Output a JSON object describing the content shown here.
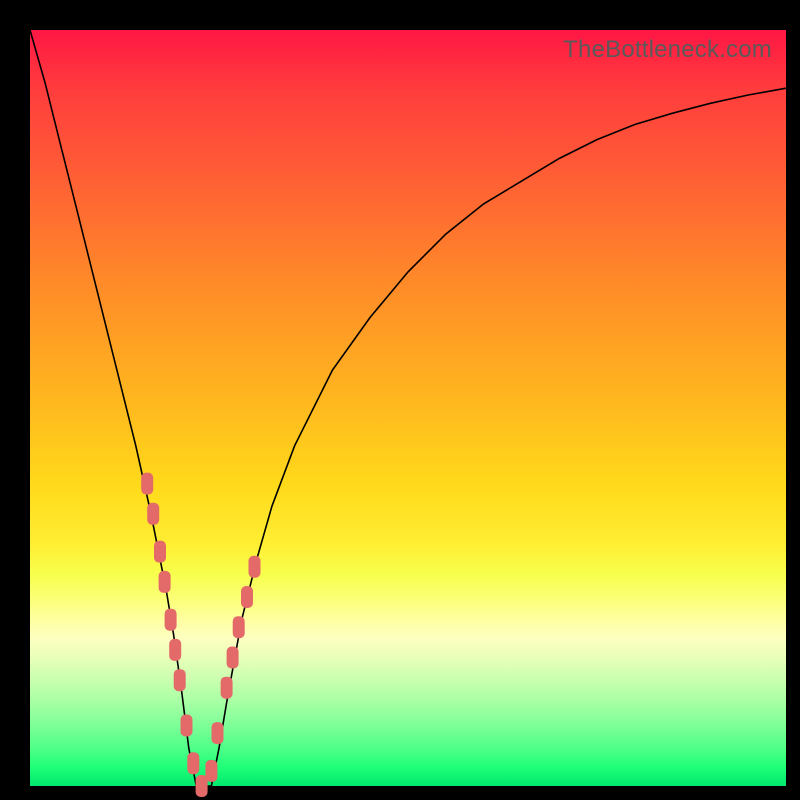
{
  "watermark": "TheBottleneck.com",
  "colors": {
    "frame": "#000000",
    "markers": "#e46a6a",
    "curve": "#000000",
    "gradient_top": "#ff1744",
    "gradient_bottom": "#00e86e"
  },
  "chart_data": {
    "type": "line",
    "title": "",
    "xlabel": "",
    "ylabel": "",
    "xlim": [
      0,
      100
    ],
    "ylim": [
      0,
      100
    ],
    "grid": false,
    "series": [
      {
        "name": "bottleneck-curve",
        "x": [
          0,
          2,
          4,
          6,
          8,
          10,
          12,
          14,
          16,
          17,
          18,
          19,
          20,
          21,
          22,
          23,
          24,
          25,
          26,
          28,
          30,
          32,
          35,
          40,
          45,
          50,
          55,
          60,
          65,
          70,
          75,
          80,
          85,
          90,
          95,
          100
        ],
        "y": [
          100,
          93,
          85,
          77,
          69,
          61,
          53,
          45,
          36,
          31,
          26,
          20,
          13,
          5,
          0,
          0,
          0,
          5,
          11,
          22,
          30,
          37,
          45,
          55,
          62,
          68,
          73,
          77,
          80,
          83,
          85.5,
          87.5,
          89,
          90.3,
          91.4,
          92.3
        ]
      }
    ],
    "markers": {
      "shape": "rounded-rect",
      "width": 12,
      "height": 22,
      "points": [
        {
          "x": 15.5,
          "y": 40
        },
        {
          "x": 16.3,
          "y": 36
        },
        {
          "x": 17.2,
          "y": 31
        },
        {
          "x": 17.8,
          "y": 27
        },
        {
          "x": 18.6,
          "y": 22
        },
        {
          "x": 19.2,
          "y": 18
        },
        {
          "x": 19.8,
          "y": 14
        },
        {
          "x": 20.7,
          "y": 8
        },
        {
          "x": 21.6,
          "y": 3
        },
        {
          "x": 22.7,
          "y": 0
        },
        {
          "x": 24.0,
          "y": 2
        },
        {
          "x": 24.8,
          "y": 7
        },
        {
          "x": 26.0,
          "y": 13
        },
        {
          "x": 26.8,
          "y": 17
        },
        {
          "x": 27.6,
          "y": 21
        },
        {
          "x": 28.7,
          "y": 25
        },
        {
          "x": 29.7,
          "y": 29
        }
      ]
    },
    "annotations": []
  }
}
